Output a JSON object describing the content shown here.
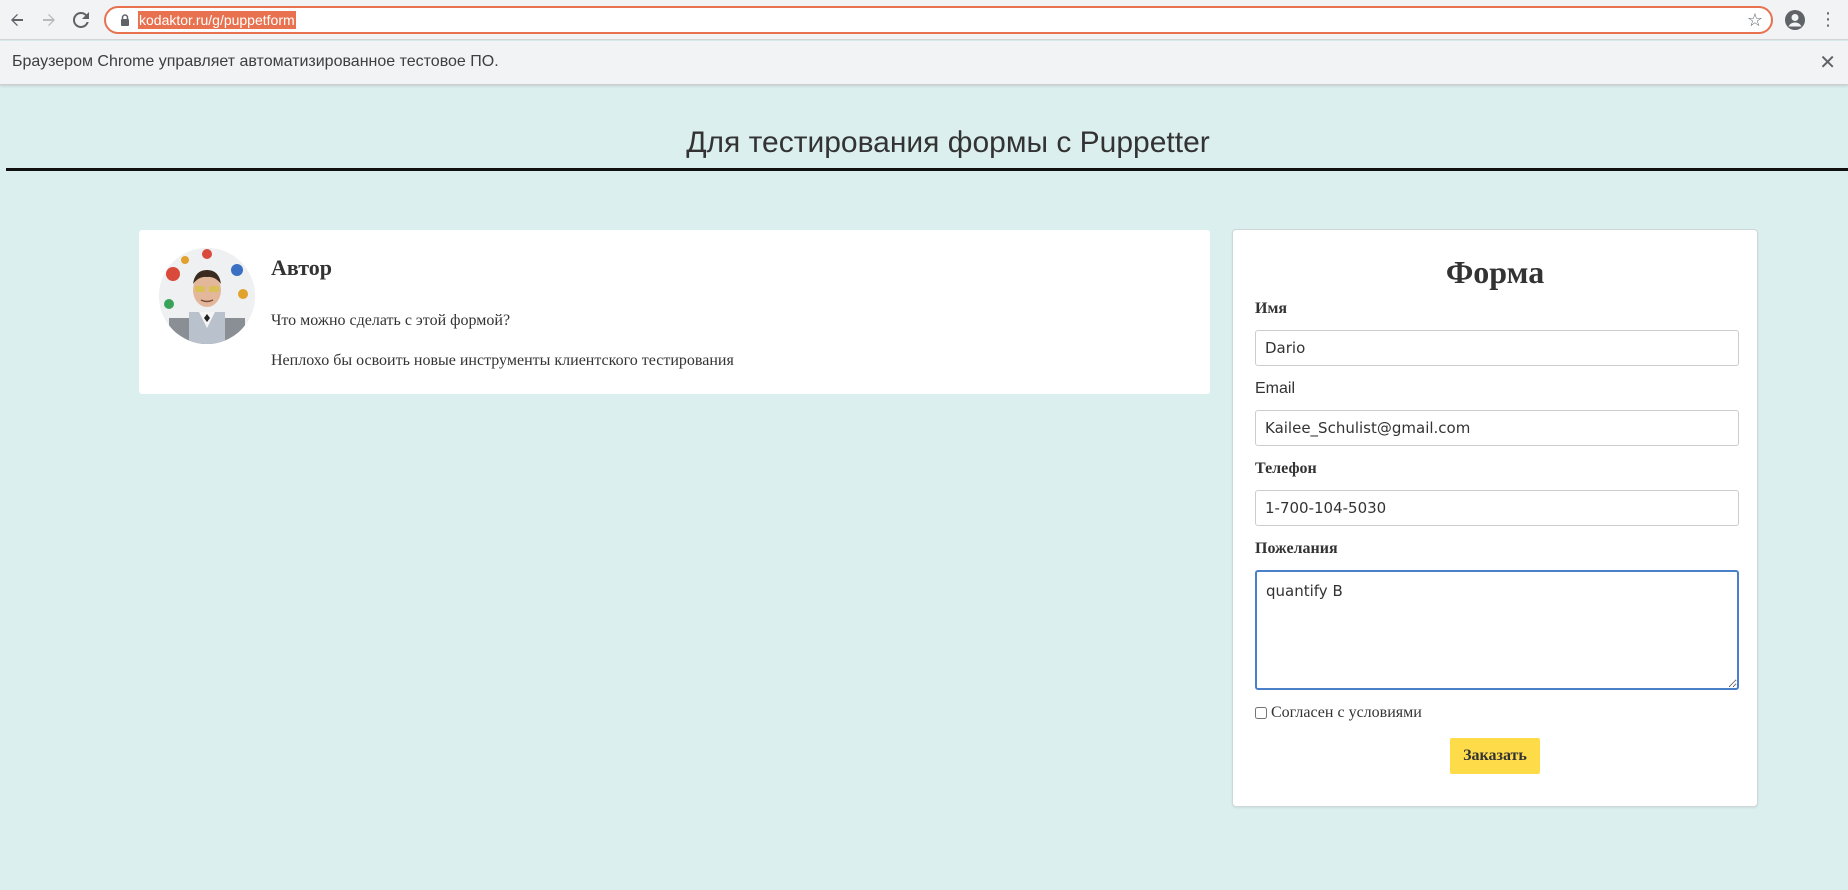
{
  "browser": {
    "url": "kodaktor.ru/g/puppetform",
    "infobar_text": "Браузером Chrome управляет автоматизированное тестовое ПО.",
    "accent_color": "#e8724f"
  },
  "page": {
    "title": "Для тестирования формы с Puppetter",
    "background_color": "#dcefef"
  },
  "author": {
    "title": "Автор",
    "question": "Что можно сделать с этой формой?",
    "answer": "Неплохо бы освоить новые инструменты клиентского тестирования"
  },
  "form": {
    "title": "Форма",
    "name_label": "Имя",
    "name_value": "Dario",
    "email_label": "Email",
    "email_value": "Kailee_Schulist@gmail.com",
    "phone_label": "Телефон",
    "phone_value": "1-700-104-5030",
    "wishes_label": "Пожелания",
    "wishes_value": "quantify B",
    "agree_label": "Согласен с условиями",
    "agree_checked": false,
    "submit_label": "Заказать",
    "submit_color": "#fedb48"
  }
}
